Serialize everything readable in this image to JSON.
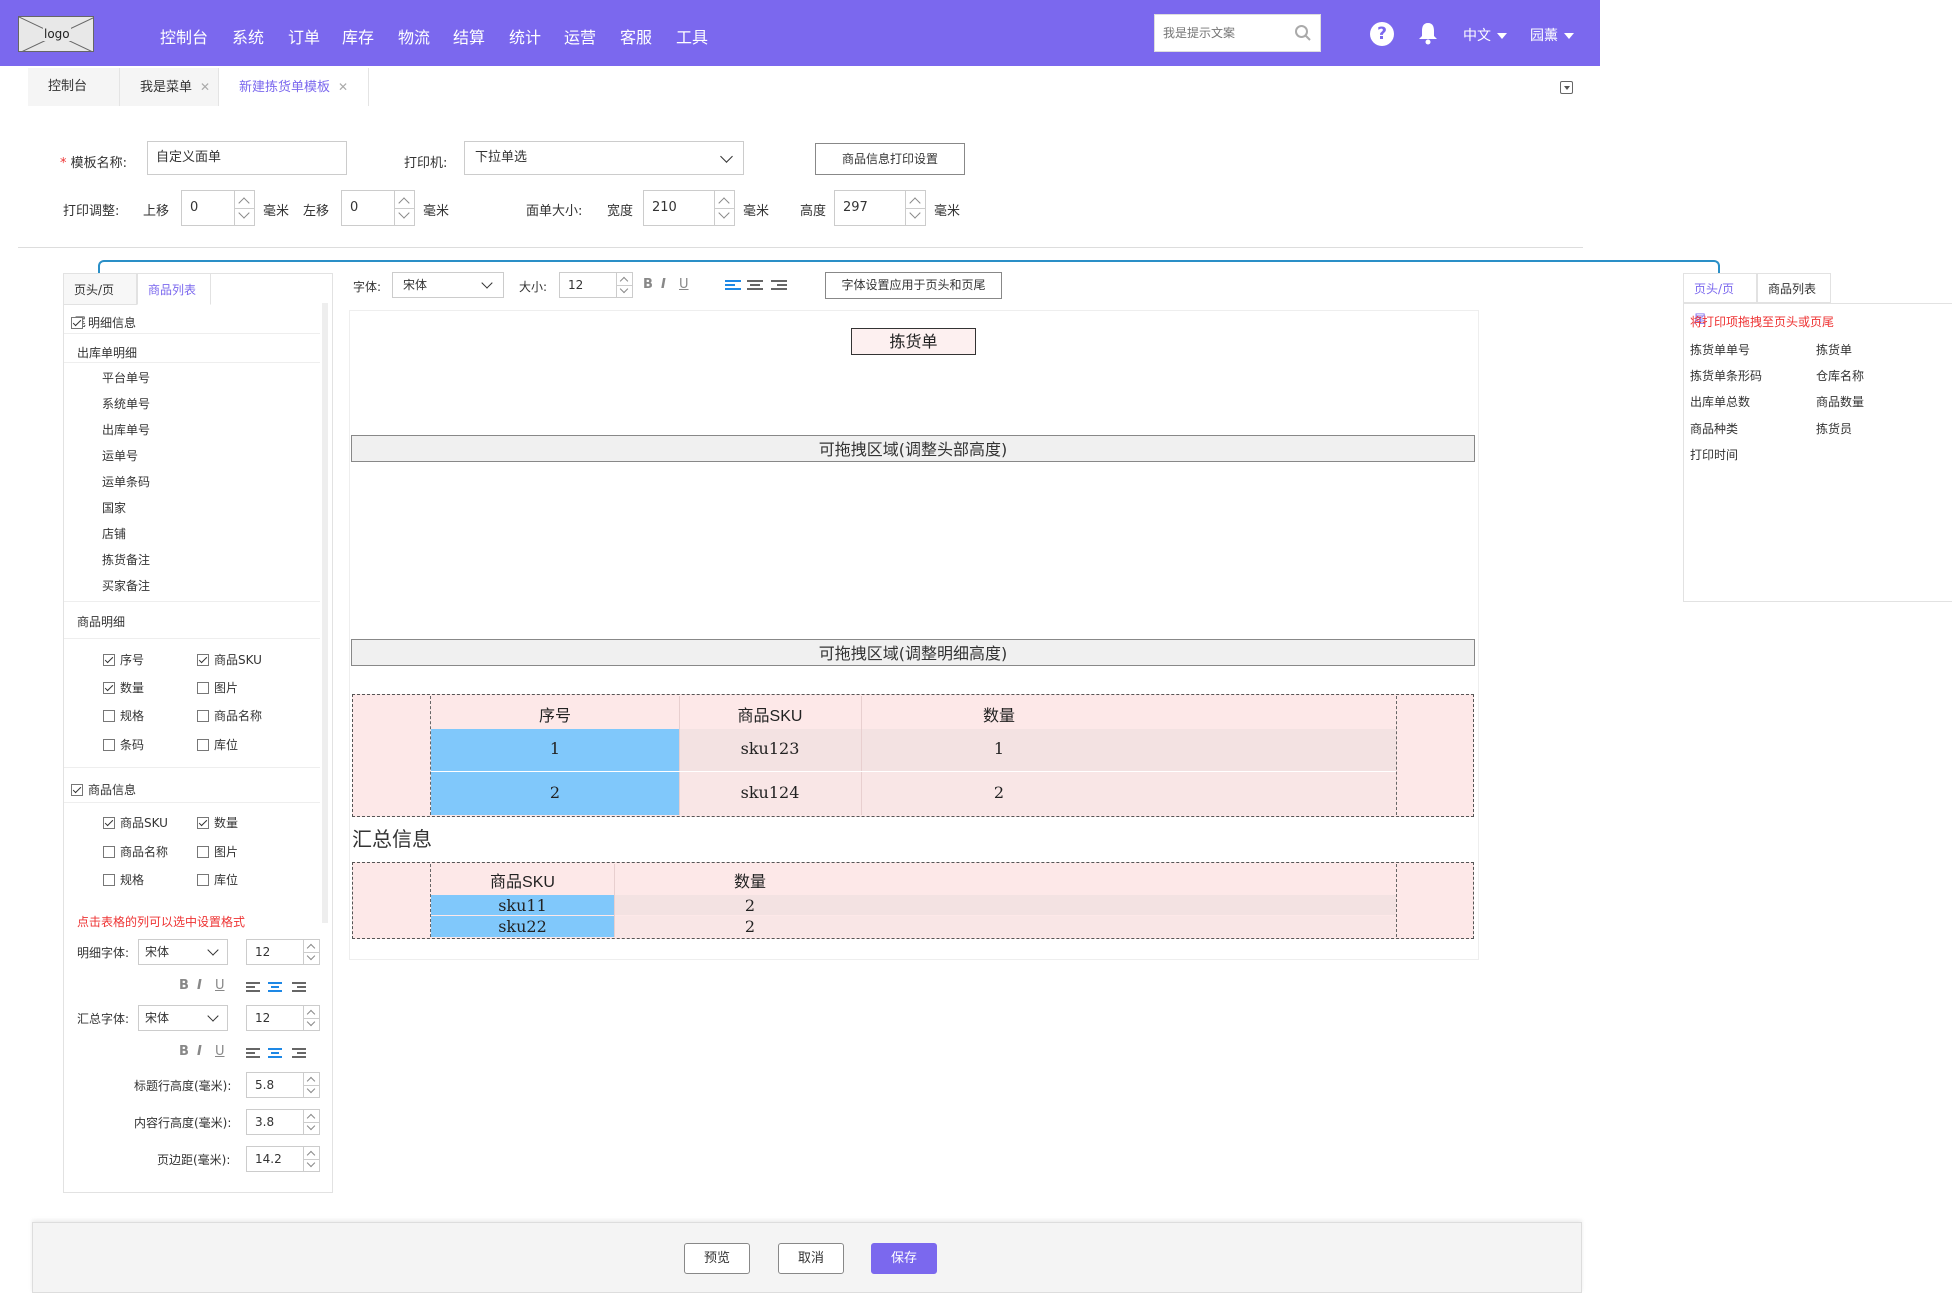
{
  "nav": {
    "logo": "logo",
    "items": [
      "控制台",
      "系统",
      "订单",
      "库存",
      "物流",
      "结算",
      "统计",
      "运营",
      "客服",
      "工具"
    ],
    "search_placeholder": "我是提示文案",
    "lang": "中文",
    "user": "园薰",
    "accent": "#7b68ee"
  },
  "tabs": [
    {
      "label": "控制台"
    },
    {
      "label": "我是菜单"
    },
    {
      "label": "新建拣货单模板"
    }
  ],
  "form": {
    "template_name_label": "模板名称:",
    "template_name_value": "自定义面单",
    "printer_label": "打印机:",
    "printer_value": "下拉单选",
    "print_settings_button": "商品信息打印设置",
    "print_adjust_label": "打印调整:",
    "up_label": "上移",
    "up_value": "0",
    "left_label": "左移",
    "left_value": "0",
    "unit": "毫米",
    "size_label": "面单大小:",
    "width_label": "宽度",
    "width_value": "210",
    "height_label": "高度",
    "height_value": "297"
  },
  "toolbar": {
    "font_label": "字体:",
    "font_value": "宋体",
    "size_label": "大小:",
    "size_value": "12",
    "bold": "B",
    "italic": "I",
    "underline": "U",
    "apply_button": "字体设置应用于页头和页尾"
  },
  "left_panel": {
    "tabs": [
      "页头/页尾",
      "商品列表"
    ],
    "detail_info": "明细信息",
    "outbound_detail": "出库单明细",
    "outbound_fields": [
      "平台单号",
      "系统单号",
      "出库单号",
      "运单号",
      "运单条码",
      "国家",
      "店铺",
      "拣货备注",
      "买家备注"
    ],
    "goods_detail": "商品明细",
    "goods_detail_fields": [
      {
        "label": "序号",
        "checked": true
      },
      {
        "label": "商品SKU",
        "checked": true
      },
      {
        "label": "数量",
        "checked": true
      },
      {
        "label": "图片",
        "checked": false
      },
      {
        "label": "规格",
        "checked": false
      },
      {
        "label": "商品名称",
        "checked": false
      },
      {
        "label": "条码",
        "checked": false
      },
      {
        "label": "库位",
        "checked": false
      }
    ],
    "goods_info": "商品信息",
    "goods_info_fields": [
      {
        "label": "商品SKU",
        "checked": true
      },
      {
        "label": "数量",
        "checked": true
      },
      {
        "label": "商品名称",
        "checked": false
      },
      {
        "label": "图片",
        "checked": false
      },
      {
        "label": "规格",
        "checked": false
      },
      {
        "label": "库位",
        "checked": false
      }
    ],
    "hint": "点击表格的列可以选中设置格式",
    "detail_font_label": "明细字体:",
    "detail_font_value": "宋体",
    "detail_size_value": "12",
    "summary_font_label": "汇总字体:",
    "summary_font_value": "宋体",
    "summary_size_value": "12",
    "title_row_height_label": "标题行高度(毫米):",
    "title_row_height_value": "5.8",
    "content_row_height_label": "内容行高度(毫米):",
    "content_row_height_value": "3.8",
    "margin_label": "页边距(毫米):",
    "margin_value": "14.2",
    "bold": "B",
    "italic": "I",
    "underline": "U"
  },
  "canvas": {
    "title": "拣货单",
    "drag_header": "可拖拽区域(调整头部高度)",
    "drag_detail": "可拖拽区域(调整明细高度)",
    "detail_table": {
      "headers": [
        "序号",
        "商品SKU",
        "数量"
      ],
      "rows": [
        [
          "1",
          "sku123",
          "1"
        ],
        [
          "2",
          "sku124",
          "2"
        ]
      ]
    },
    "summary_title": "汇总信息",
    "summary_table": {
      "headers": [
        "商品SKU",
        "数量"
      ],
      "rows": [
        [
          "sku11",
          "2"
        ],
        [
          "sku22",
          "2"
        ]
      ]
    }
  },
  "right_panel": {
    "tabs": [
      "页头/页尾",
      "商品列表"
    ],
    "hint": "将打印项拖拽至页头或页尾",
    "items": [
      "拣货单单号",
      "拣货单",
      "拣货单条形码",
      "仓库名称",
      "出库单总数",
      "商品数量",
      "商品种类",
      "拣货员",
      "打印时间"
    ]
  },
  "footer": {
    "preview": "预览",
    "cancel": "取消",
    "save": "保存"
  }
}
